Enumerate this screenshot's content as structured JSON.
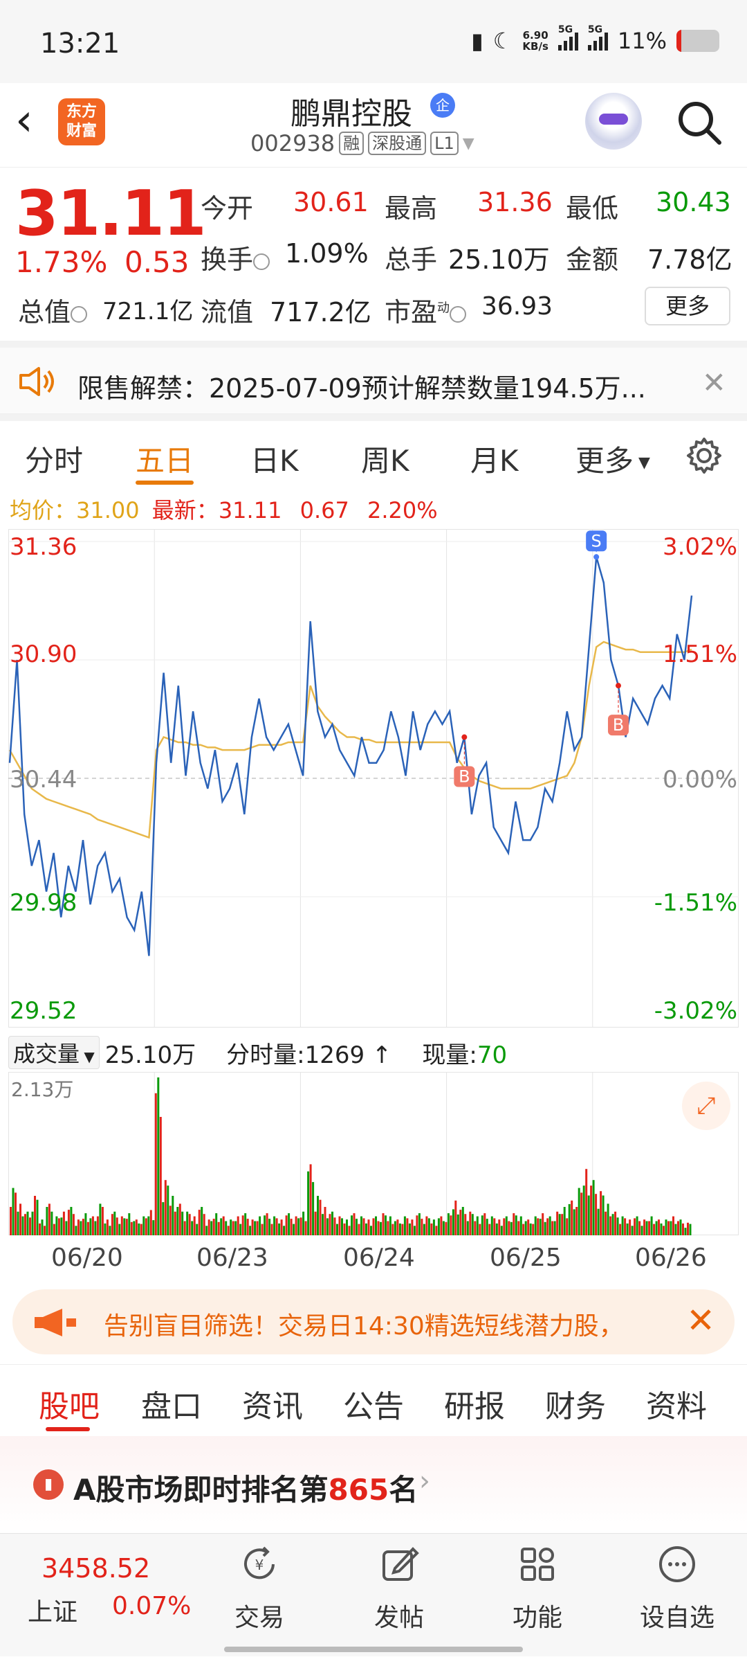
{
  "status_bar": {
    "time": "13:21",
    "net_speed_top": "6.90",
    "net_speed_bottom": "KB/s",
    "sig1": "5G",
    "sig2": "5G",
    "battery": "11%",
    "battery_level": 0.11
  },
  "header": {
    "logo_line1": "东方",
    "logo_line2": "财富",
    "stock_name": "鹏鼎控股",
    "badge": "企",
    "code": "002938",
    "tag_rong": "融",
    "tag_sgt": "深股通",
    "tag_l1": "L1"
  },
  "quote": {
    "price": "31.11",
    "pct": "1.73%",
    "change": "0.53",
    "open_label": "今开",
    "open": "30.61",
    "high_label": "最高",
    "high": "31.36",
    "low_label": "最低",
    "low": "30.43",
    "turnover_label": "换手",
    "turnover": "1.09%",
    "volume_label": "总手",
    "volume": "25.10万",
    "amount_label": "金额",
    "amount": "7.78亿",
    "mktcap_label": "总值",
    "mktcap": "721.1亿",
    "float_label": "流值",
    "float": "717.2亿",
    "pe_label": "市盈",
    "pe_sup": "动",
    "pe": "36.93",
    "more_button": "更多"
  },
  "notice": {
    "text": "限售解禁：2025-07-09预计解禁数量194.5万..."
  },
  "chart_tabs": {
    "items": [
      "分时",
      "五日",
      "日K",
      "周K",
      "月K",
      "更多"
    ],
    "active": "五日"
  },
  "chart_info": {
    "avg_label": "均价：",
    "avg": "31.00",
    "latest_label": "最新：",
    "latest": "31.11",
    "chg": "0.67",
    "pct": "2.20%"
  },
  "chart_data": {
    "type": "line",
    "title": "",
    "x_days": [
      "06/20",
      "06/23",
      "06/24",
      "06/25",
      "06/26"
    ],
    "ylim": [
      29.52,
      31.36
    ],
    "y_ticks_left": [
      "31.36",
      "30.90",
      "30.44",
      "29.98",
      "29.52"
    ],
    "y_ticks_right": [
      "3.02%",
      "1.51%",
      "0.00%",
      "-1.51%",
      "-3.02%"
    ],
    "prev_close": 30.44,
    "series": [
      {
        "values": [
          30.5,
          30.9,
          30.3,
          30.1,
          30.2,
          30.0,
          30.15,
          29.9,
          30.1,
          30.0,
          30.2,
          29.95,
          30.1,
          30.15,
          30.0,
          30.05,
          29.9,
          29.85,
          30.0,
          29.75,
          30.5,
          30.85,
          30.5,
          30.8,
          30.45,
          30.7,
          30.5,
          30.4,
          30.55,
          30.35,
          30.4,
          30.5,
          30.3,
          30.6,
          30.75,
          30.6,
          30.55,
          30.6,
          30.65,
          30.55,
          30.45,
          31.05,
          30.7,
          30.6,
          30.65,
          30.55,
          30.5,
          30.45,
          30.6,
          30.5,
          30.5,
          30.55,
          30.7,
          30.6,
          30.45,
          30.7,
          30.55,
          30.65,
          30.7,
          30.65,
          30.7,
          30.5,
          30.6,
          30.3,
          30.45,
          30.5,
          30.25,
          30.2,
          30.15,
          30.35,
          30.2,
          30.2,
          30.25,
          30.4,
          30.35,
          30.5,
          30.7,
          30.55,
          30.6,
          30.95,
          31.3,
          31.2,
          30.9,
          30.8,
          30.6,
          30.75,
          30.7,
          30.65,
          30.75,
          30.8,
          30.75,
          31.0,
          30.9,
          31.15
        ]
      },
      {
        "values": [
          30.55,
          30.5,
          30.45,
          30.4,
          30.38,
          30.36,
          30.35,
          30.34,
          30.33,
          30.32,
          30.31,
          30.3,
          30.28,
          30.27,
          30.26,
          30.25,
          30.24,
          30.23,
          30.22,
          30.21,
          30.55,
          30.6,
          30.59,
          30.58,
          30.58,
          30.57,
          30.57,
          30.56,
          30.56,
          30.55,
          30.55,
          30.55,
          30.55,
          30.56,
          30.57,
          30.57,
          30.57,
          30.57,
          30.58,
          30.58,
          30.58,
          30.8,
          30.72,
          30.68,
          30.65,
          30.62,
          30.6,
          30.6,
          30.59,
          30.59,
          30.58,
          30.58,
          30.58,
          30.58,
          30.58,
          30.58,
          30.58,
          30.58,
          30.58,
          30.58,
          30.58,
          30.52,
          30.48,
          30.45,
          30.43,
          30.42,
          30.41,
          30.4,
          30.4,
          30.4,
          30.4,
          30.4,
          30.41,
          30.42,
          30.43,
          30.44,
          30.45,
          30.5,
          30.6,
          30.8,
          30.95,
          30.97,
          30.96,
          30.95,
          30.94,
          30.94,
          30.93,
          30.93,
          30.93,
          30.93,
          30.93,
          30.93,
          30.93,
          30.94
        ]
      }
    ],
    "markers": [
      {
        "label": "S",
        "index": 80
      },
      {
        "label": "B",
        "index": 62
      },
      {
        "label": "B",
        "index": 83
      }
    ],
    "volume": {
      "max_label": "2.13万",
      "values": [
        0.3,
        0.2,
        0.15,
        0.25,
        0.1,
        0.2,
        0.12,
        0.15,
        0.18,
        0.1,
        0.14,
        0.12,
        0.2,
        0.1,
        0.15,
        0.12,
        0.14,
        0.1,
        0.12,
        0.16,
        1.0,
        0.35,
        0.25,
        0.2,
        0.15,
        0.12,
        0.18,
        0.1,
        0.14,
        0.12,
        0.1,
        0.12,
        0.14,
        0.1,
        0.12,
        0.14,
        0.12,
        0.1,
        0.14,
        0.12,
        0.15,
        0.45,
        0.25,
        0.18,
        0.15,
        0.12,
        0.1,
        0.14,
        0.12,
        0.1,
        0.12,
        0.14,
        0.12,
        0.1,
        0.12,
        0.1,
        0.14,
        0.12,
        0.1,
        0.12,
        0.14,
        0.22,
        0.18,
        0.15,
        0.12,
        0.14,
        0.12,
        0.1,
        0.12,
        0.14,
        0.12,
        0.1,
        0.12,
        0.14,
        0.12,
        0.15,
        0.18,
        0.22,
        0.3,
        0.42,
        0.35,
        0.28,
        0.2,
        0.15,
        0.12,
        0.1,
        0.12,
        0.1,
        0.12,
        0.1,
        0.1,
        0.12,
        0.1,
        0.08
      ]
    }
  },
  "volume_header": {
    "select": "成交量",
    "total": "25.10万",
    "fenshi_label": "分时量:",
    "fenshi": "1269",
    "arrow": "↑",
    "xianliang_label": "现量:",
    "xianliang": "70"
  },
  "promo": {
    "text": "告别盲目筛选！交易日14:30精选短线潜力股，"
  },
  "info_tabs": {
    "items": [
      "股吧",
      "盘口",
      "资讯",
      "公告",
      "研报",
      "财务",
      "资料"
    ],
    "active": "股吧"
  },
  "ranking": {
    "prefix": "A股市场即时排名第",
    "rank": "865",
    "suffix": "名"
  },
  "bottom_nav": {
    "index_value": "3458.52",
    "index_name": "上证",
    "index_chg": "0.07%",
    "items": [
      "交易",
      "发帖",
      "功能",
      "设自选"
    ]
  },
  "colors": {
    "accent": "#e87a0a",
    "up": "#e2231a",
    "down": "#0a9a0a",
    "price_line": "#2a62b8",
    "avg_line": "#e8b84a"
  }
}
